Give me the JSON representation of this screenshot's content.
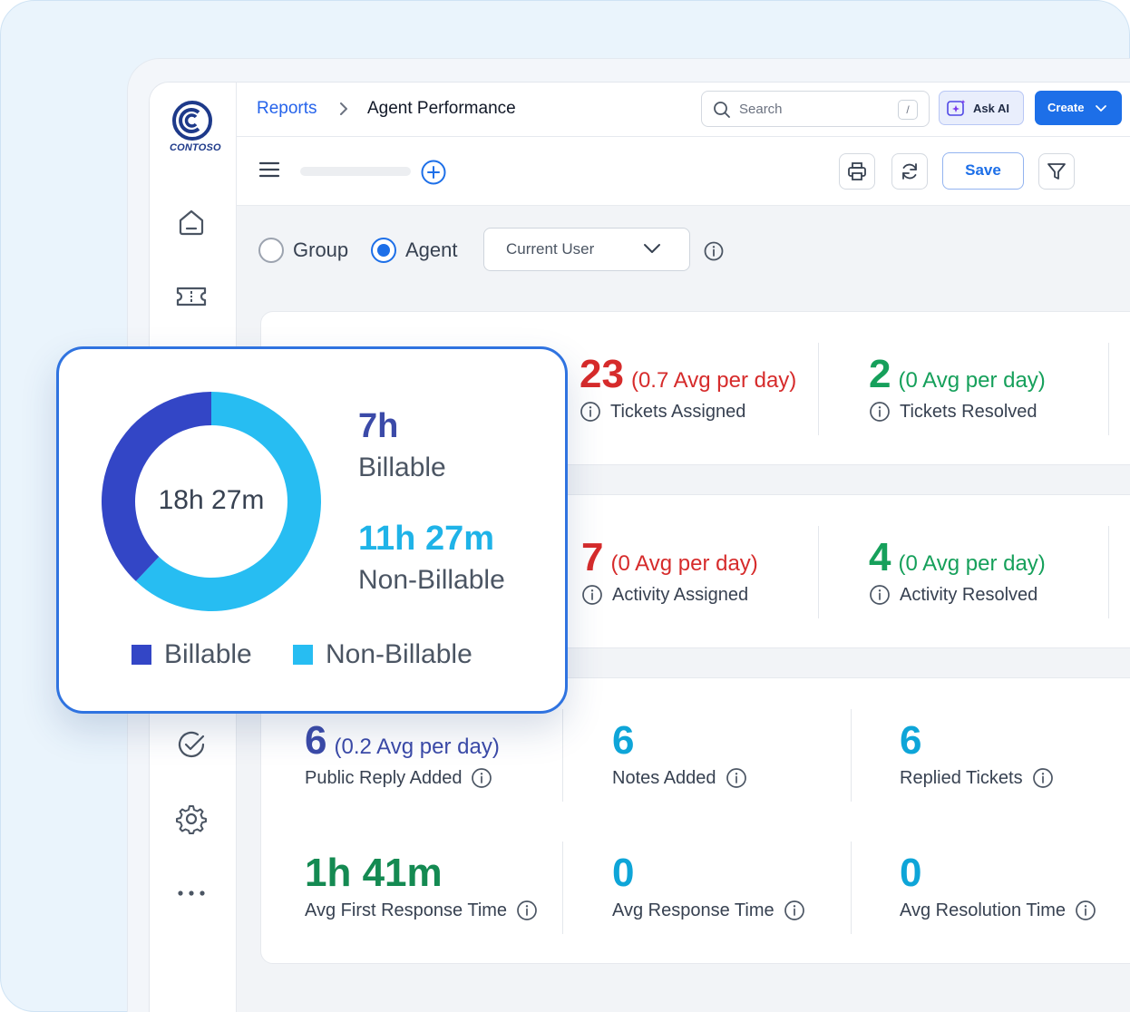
{
  "breadcrumb": {
    "parent": "Reports",
    "current": "Agent Performance"
  },
  "logo": {
    "text": "CONTOSO"
  },
  "search": {
    "placeholder": "Search",
    "shortcut": "/"
  },
  "header": {
    "ask_ai_label": "Ask AI",
    "create_label": "Create"
  },
  "toolbar": {
    "save_label": "Save"
  },
  "filters": {
    "options": [
      "Group",
      "Agent"
    ],
    "selected": "Agent",
    "user_select_value": "Current User"
  },
  "metrics": {
    "tickets_assigned": {
      "value": "23",
      "avg": "(0.7 Avg per day)",
      "label": "Tickets Assigned"
    },
    "tickets_resolved": {
      "value": "2",
      "avg": "(0 Avg per day)",
      "label": "Tickets Resolved"
    },
    "activity_assigned": {
      "value": "7",
      "avg": "(0 Avg per day)",
      "label": "Activity Assigned"
    },
    "activity_resolved": {
      "value": "4",
      "avg": "(0 Avg per day)",
      "label": "Activity Resolved"
    },
    "public_reply": {
      "value": "6",
      "avg": "(0.2 Avg per day)",
      "label": "Public Reply Added"
    },
    "notes_added": {
      "value": "6",
      "label": "Notes Added"
    },
    "replied_tickets": {
      "value": "6",
      "label": "Replied Tickets"
    },
    "avg_first_response": {
      "value": "1h 41m",
      "label": "Avg First Response Time"
    },
    "avg_response": {
      "value": "0",
      "label": "Avg Response Time"
    },
    "avg_resolution": {
      "value": "0",
      "label": "Avg Resolution Time"
    }
  },
  "time_card": {
    "total": "18h 27m",
    "billable_value": "7h",
    "billable_label": "Billable",
    "non_billable_value": "11h 27m",
    "non_billable_label": "Non-Billable",
    "legend": [
      "Billable",
      "Non-Billable"
    ]
  },
  "chart_data": {
    "type": "pie",
    "title": "",
    "categories": [
      "Billable",
      "Non-Billable"
    ],
    "values": [
      420,
      687
    ],
    "units": "minutes",
    "colors": [
      "#3346c6",
      "#27bdf2"
    ],
    "legend_position": "bottom"
  },
  "colors": {
    "accent": "#1d6fe8",
    "red": "#d62b2b",
    "green": "#16a05b",
    "billable": "#3346c6",
    "non_billable": "#27bdf2"
  }
}
